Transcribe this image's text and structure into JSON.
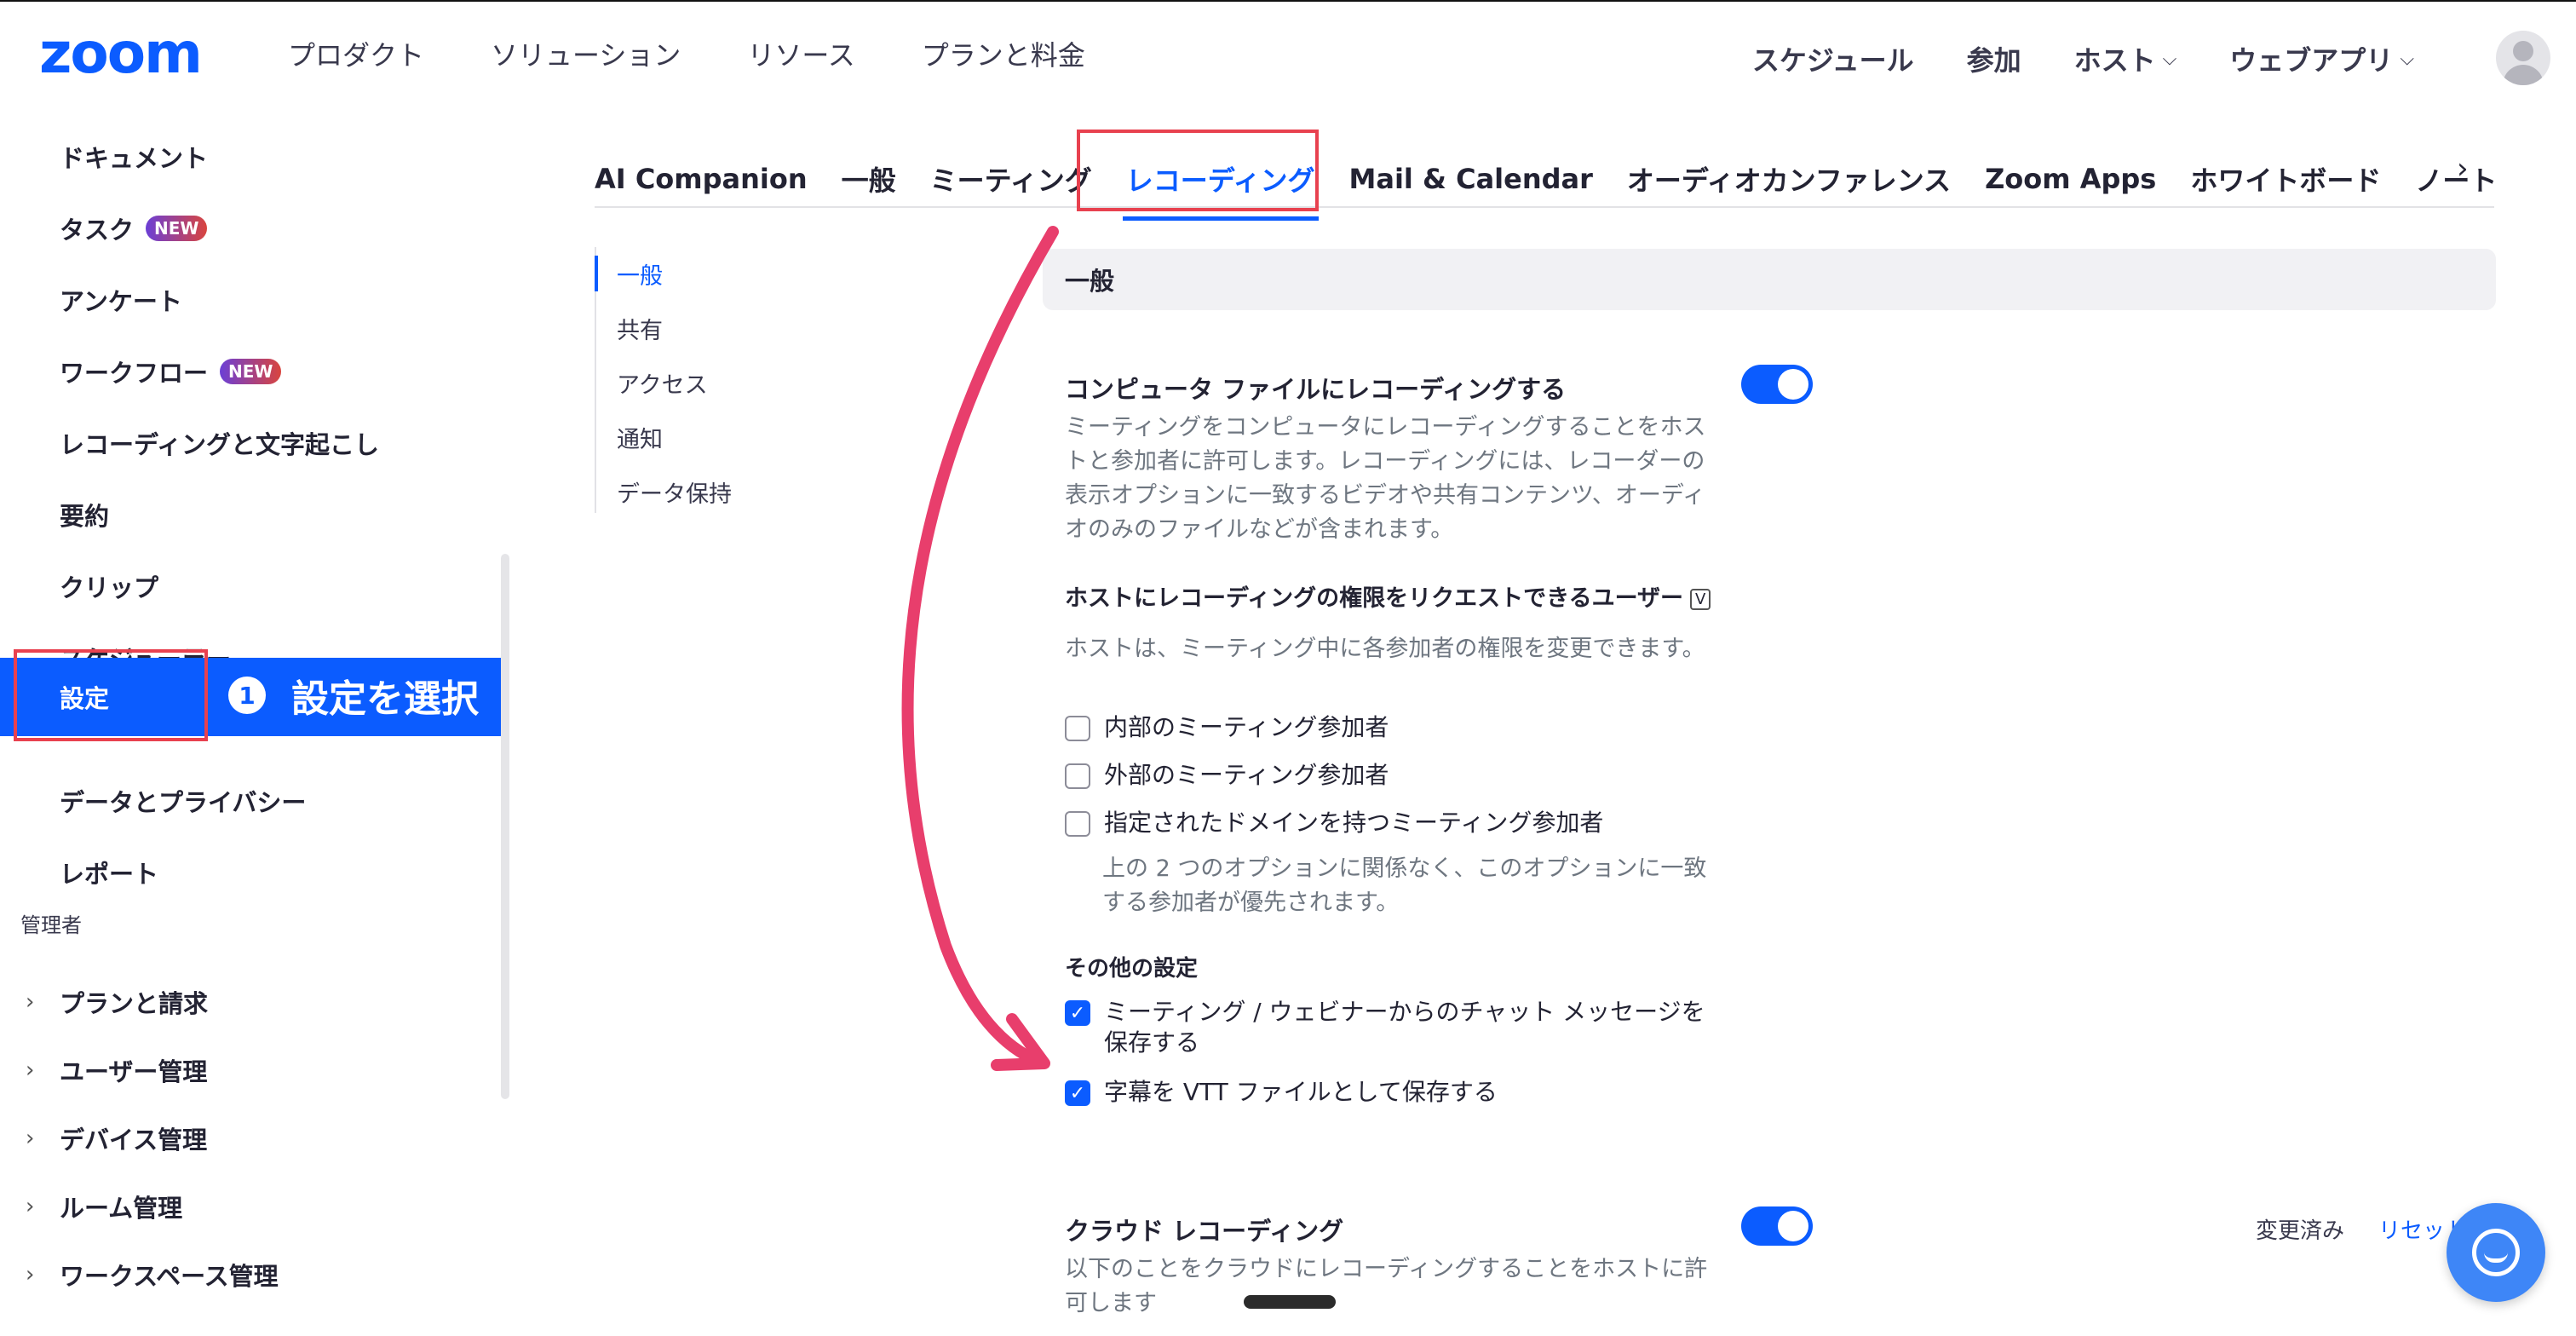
{
  "topnav": {
    "logo": "zoom",
    "left_items": [
      "プロダクト",
      "ソリューション",
      "リソース",
      "プランと料金"
    ],
    "right_items": [
      {
        "label": "スケジュール",
        "dropdown": false
      },
      {
        "label": "参加",
        "dropdown": false
      },
      {
        "label": "ホスト",
        "dropdown": true
      },
      {
        "label": "ウェブアプリ",
        "dropdown": true
      }
    ],
    "dropdown_icon": "⌵"
  },
  "sidebar": {
    "items": [
      {
        "label": "ドキュメント",
        "badge": ""
      },
      {
        "label": "タスク",
        "badge": "NEW"
      },
      {
        "label": "アンケート",
        "badge": ""
      },
      {
        "label": "ワークフロー",
        "badge": "NEW"
      },
      {
        "label": "レコーディングと文字起こし",
        "badge": ""
      },
      {
        "label": "要約",
        "badge": ""
      },
      {
        "label": "クリップ",
        "badge": ""
      },
      {
        "label": "スケジューラー",
        "badge": ""
      },
      {
        "label": "設定",
        "badge": "",
        "active": true
      },
      {
        "label": "データとプライバシー",
        "badge": ""
      },
      {
        "label": "レポート",
        "badge": ""
      }
    ],
    "admin_section": "管理者",
    "admin_items": [
      "プランと請求",
      "ユーザー管理",
      "デバイス管理",
      "ルーム管理",
      "ワークスペース管理"
    ],
    "annotation": {
      "number": "1",
      "text": "設定を選択"
    }
  },
  "tabs": {
    "items": [
      "AI Companion",
      "一般",
      "ミーティング",
      "レコーディング",
      "Mail & Calendar",
      "オーディオカンファレンス",
      "Zoom Apps",
      "ホワイトボード",
      "ノート"
    ],
    "active": "レコーディング",
    "more_icon": "›"
  },
  "subnav": {
    "items": [
      "一般",
      "共有",
      "アクセス",
      "通知",
      "データ保持"
    ],
    "active": "一般"
  },
  "panel": {
    "header": "一般",
    "local_recording": {
      "title": "コンピュータ ファイルにレコーディングする",
      "description": "ミーティングをコンピュータにレコーディングすることをホストと参加者に許可します。レコーディングには、レコーダーの表示オプションに一致するビデオや共有コンテンツ、オーディオのみのファイルなどが含まれます。",
      "enabled": true
    },
    "request_permission": {
      "title": "ホストにレコーディングの権限をリクエストできるユーザー",
      "badge": "V",
      "description": "ホストは、ミーティング中に各参加者の権限を変更できます。",
      "options": [
        {
          "label": "内部のミーティング参加者",
          "checked": false
        },
        {
          "label": "外部のミーティング参加者",
          "checked": false
        },
        {
          "label": "指定されたドメインを持つミーティング参加者",
          "checked": false
        }
      ],
      "note": "上の 2 つのオプションに関係なく、このオプションに一致する参加者が優先されます。"
    },
    "other_settings": {
      "title": "その他の設定",
      "options": [
        {
          "label": "ミーティング / ウェビナーからのチャット メッセージを保存する",
          "checked": true
        },
        {
          "label": "字幕を VTT ファイルとして保存する",
          "checked": true
        }
      ]
    },
    "cloud_recording": {
      "title": "クラウド レコーディング",
      "description": "以下のことをクラウドにレコーディングすることをホストに許可します",
      "enabled": true,
      "changed_label": "変更済み",
      "reset_label": "リセット"
    }
  },
  "colors": {
    "brand": "#0b5cff",
    "annotation_red": "#e8414f",
    "arrow_pink": "#e83e6c"
  }
}
